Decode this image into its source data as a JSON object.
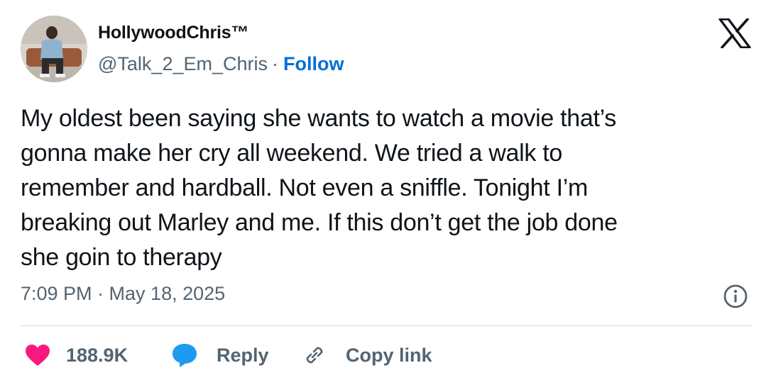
{
  "author": {
    "display_name": "HollywoodChris™",
    "handle": "@Talk_2_Em_Chris",
    "separator": "·",
    "follow_label": "Follow"
  },
  "tweet": {
    "text": "My oldest been saying she wants to watch a movie that’s\ngonna make her cry all weekend. We tried a walk to\nremember and hardball. Not even a sniffle. Tonight I’m\nbreaking out Marley and me. If this don’t get the job done\nshe goin to therapy",
    "timestamp": "7:09 PM · May 18, 2025"
  },
  "actions": {
    "like_count": "188.9K",
    "reply_label": "Reply",
    "copy_link_label": "Copy link"
  },
  "icons": {
    "brand": "x-logo-icon",
    "info": "info-icon",
    "like": "heart-icon",
    "reply": "speech-bubble-icon",
    "copy": "link-icon"
  },
  "colors": {
    "like": "#f91880",
    "reply": "#1d9bf0",
    "follow": "#006fd6",
    "secondary_text": "#536471",
    "primary_text": "#0f1419"
  }
}
